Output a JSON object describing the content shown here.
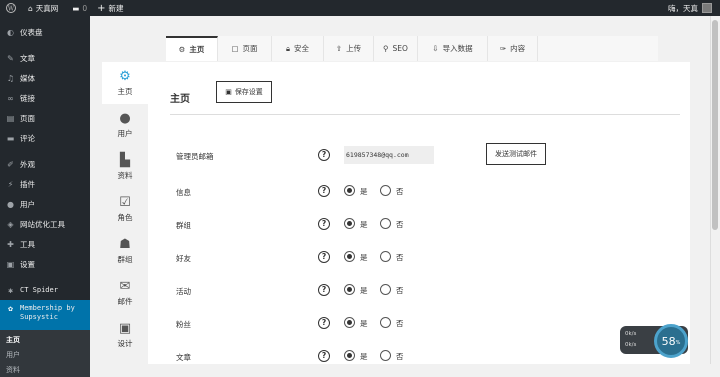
{
  "topbar": {
    "site_name": "天真网",
    "comments_count": "0",
    "new_label": "新建",
    "greeting": "嗨，天真"
  },
  "sidebar": {
    "items": [
      {
        "icon": "dashboard-icon",
        "label": "仪表盘"
      },
      {
        "icon": "posts-icon",
        "label": "文章"
      },
      {
        "icon": "media-icon",
        "label": "媒体"
      },
      {
        "icon": "links-icon",
        "label": "链接"
      },
      {
        "icon": "pages-icon",
        "label": "页面"
      },
      {
        "icon": "comments-icon",
        "label": "评论"
      },
      {
        "icon": "appearance-icon",
        "label": "外观"
      },
      {
        "icon": "plugins-icon",
        "label": "插件"
      },
      {
        "icon": "users-icon",
        "label": "用户"
      },
      {
        "icon": "seo-icon",
        "label": "网站优化工具"
      },
      {
        "icon": "tools-icon",
        "label": "工具"
      },
      {
        "icon": "settings-icon",
        "label": "设置"
      },
      {
        "icon": "spider-icon",
        "label": "CT Spider"
      }
    ],
    "active_label": "Membership by Supsystic",
    "submenu": [
      "主页",
      "用户",
      "资料"
    ]
  },
  "tabs": [
    {
      "icon": "gear-icon",
      "label": "主页"
    },
    {
      "icon": "page-icon",
      "label": "页面"
    },
    {
      "icon": "lock-icon",
      "label": "安全"
    },
    {
      "icon": "upload-icon",
      "label": "上传"
    },
    {
      "icon": "search-icon",
      "label": "SEO"
    },
    {
      "icon": "download-icon",
      "label": "导入数据"
    },
    {
      "icon": "plug-icon",
      "label": "内容"
    }
  ],
  "vnav": [
    {
      "icon": "cogs-icon",
      "label": "主页"
    },
    {
      "icon": "user-icon",
      "label": "用户"
    },
    {
      "icon": "files-icon",
      "label": "资料"
    },
    {
      "icon": "checkbox-icon",
      "label": "角色"
    },
    {
      "icon": "group-icon",
      "label": "群组"
    },
    {
      "icon": "mail-icon",
      "label": "邮件"
    },
    {
      "icon": "image-icon",
      "label": "设计"
    }
  ],
  "main": {
    "title": "主页",
    "save_label": "保存设置",
    "email_label": "管理员邮箱",
    "email_value": "619857348@qq.com",
    "test_label": "发送测试邮件",
    "yes_label": "是",
    "no_label": "否",
    "rows": [
      {
        "label": "信息",
        "value": "是"
      },
      {
        "label": "群组",
        "value": "是"
      },
      {
        "label": "好友",
        "value": "是"
      },
      {
        "label": "活动",
        "value": "是"
      },
      {
        "label": "粉丝",
        "value": "是"
      },
      {
        "label": "文章",
        "value": "是"
      }
    ]
  },
  "gauge": {
    "line1": "0k/s",
    "line2": "0k/s",
    "percent": "58",
    "unit": "%"
  },
  "colors": {
    "accent": "#0073aa",
    "admin_bar": "#23282d"
  }
}
